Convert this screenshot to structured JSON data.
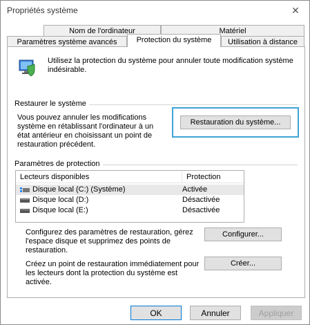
{
  "window": {
    "title": "Propriétés système",
    "close_glyph": "✕"
  },
  "tabs": {
    "row1": [
      {
        "label": "Nom de l'ordinateur"
      },
      {
        "label": "Matériel"
      }
    ],
    "row2": [
      {
        "label": "Paramètres système avancés"
      },
      {
        "label": "Protection du système",
        "active": true
      },
      {
        "label": "Utilisation à distance"
      }
    ]
  },
  "intro": {
    "text": "Utilisez la protection du système pour annuler toute modification système indésirable."
  },
  "restore": {
    "title": "Restaurer le système",
    "description": "Vous pouvez annuler les modifications système en rétablissant l'ordinateur à un état antérieur en choisissant un point de restauration précédent.",
    "button": "Restauration du système..."
  },
  "protection": {
    "title": "Paramètres de protection",
    "columns": [
      "Lecteurs disponibles",
      "Protection"
    ],
    "rows": [
      {
        "drive": "Disque local (C:) (Système)",
        "status": "Activée",
        "icon": "system-drive-icon"
      },
      {
        "drive": "Disque local (D:)",
        "status": "Désactivée",
        "icon": "drive-icon"
      },
      {
        "drive": "Disque local (E:)",
        "status": "Désactivée",
        "icon": "drive-icon"
      }
    ]
  },
  "configure": {
    "text": "Configurez des paramètres de restauration, gérez l'espace disque et supprimez des points de restauration.",
    "button": "Configurer..."
  },
  "create": {
    "text": "Créez un point de restauration immédiatement pour les lecteurs dont la protection du système est activée.",
    "button": "Créer..."
  },
  "footer": {
    "ok": "OK",
    "cancel": "Annuler",
    "apply": "Appliquer"
  },
  "colors": {
    "accent": "#0078d7",
    "focus": "#3ea3d6"
  }
}
